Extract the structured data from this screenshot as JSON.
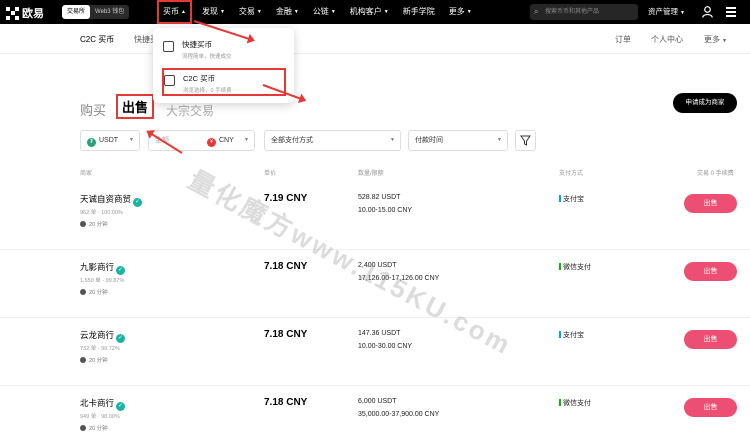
{
  "header": {
    "logo_text": "欧易",
    "switch": [
      "交易所",
      "Web3 钱包"
    ],
    "nav": [
      {
        "label": "买币",
        "caret": true
      },
      {
        "label": "发现",
        "caret": true
      },
      {
        "label": "交易",
        "caret": true
      },
      {
        "label": "金融",
        "caret": true
      },
      {
        "label": "公链",
        "caret": true
      },
      {
        "label": "机构客户",
        "caret": true
      },
      {
        "label": "新手学院",
        "caret": false
      },
      {
        "label": "更多",
        "caret": true
      }
    ],
    "search_placeholder": "搜索币币和其他产品",
    "asset_label": "资产管理"
  },
  "subnav": {
    "tabs": [
      "C2C 买币",
      "快捷买币"
    ],
    "right": [
      "订单",
      "个人中心",
      "更多"
    ]
  },
  "dropdown": {
    "items": [
      {
        "title": "快捷买币",
        "desc": "流程简单，快速成交"
      },
      {
        "title": "C2C 买币",
        "desc": "浏览选择，0 手续费"
      }
    ]
  },
  "trade": {
    "buy_label": "购买",
    "sell_label": "出售",
    "block_label": "大宗交易",
    "merchant_button": "申请成为商家"
  },
  "filters": {
    "coin": "USDT",
    "amount_placeholder": "金额",
    "fiat": "CNY",
    "payment": "全部支付方式",
    "pay_time": "付款时间"
  },
  "table": {
    "headers": {
      "merchant": "商家",
      "price": "单价",
      "limits": "数量/限额",
      "payment": "支付方式",
      "trade": "交易 0 手续费"
    },
    "rows": [
      {
        "name": "天诚自资商贸",
        "stats": "962 单 · 100.00%",
        "time": "20 分钟",
        "price": "7.19 CNY",
        "available": "528.82 USDT",
        "limit": "10.00-15.00 CNY",
        "payment": "支付宝",
        "pay_color": "#00a1e9",
        "action": "出售"
      },
      {
        "name": "九影商行",
        "stats": "1,550 单 · 99.87%",
        "time": "20 分钟",
        "price": "7.18 CNY",
        "available": "2,400 USDT",
        "limit": "17,126.00-17,126.00 CNY",
        "payment": "微信支付",
        "pay_color": "#09bb07",
        "action": "出售"
      },
      {
        "name": "云龙商行",
        "stats": "732 单 · 99.72%",
        "time": "20 分钟",
        "price": "7.18 CNY",
        "available": "147.36 USDT",
        "limit": "10.00-30.00 CNY",
        "payment": "支付宝",
        "pay_color": "#00a1e9",
        "action": "出售"
      },
      {
        "name": "北卡商行",
        "stats": "949 单 · 98.00%",
        "time": "20 分钟",
        "price": "7.18 CNY",
        "available": "6,000 USDT",
        "limit": "35,000.00-37,900.00 CNY",
        "payment": "微信支付",
        "pay_color": "#09bb07",
        "action": "出售"
      }
    ]
  },
  "watermark": "量化魔方www.115KU.com",
  "colors": {
    "accent_red": "#e53935",
    "sell_button": "#ec4f73",
    "verified": "#17b3a3"
  }
}
